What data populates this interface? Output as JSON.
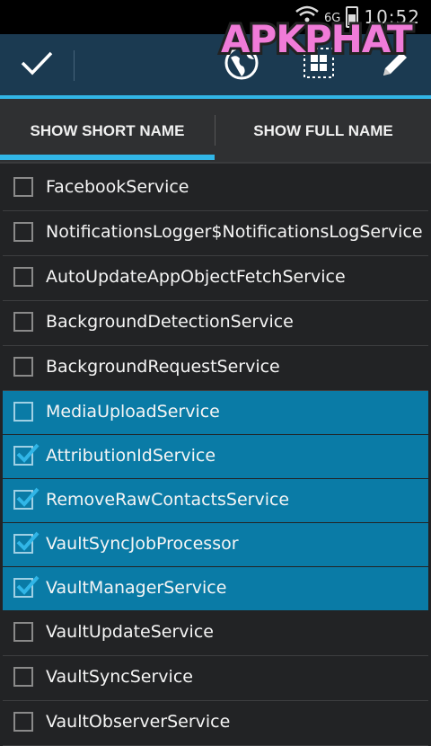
{
  "status": {
    "network": "6G",
    "clock": "10:52"
  },
  "watermark": {
    "text": "APKPHAT"
  },
  "actionbar": {
    "done_icon": "check-icon",
    "icons": [
      "globe-icon",
      "grid-select-icon",
      "pencil-icon"
    ]
  },
  "tabs": [
    {
      "label": "SHOW SHORT NAME",
      "active": true
    },
    {
      "label": "SHOW FULL NAME",
      "active": false
    }
  ],
  "services": [
    {
      "name": "FacebookService",
      "checked": false,
      "selected": false
    },
    {
      "name": "NotificationsLogger$NotificationsLogService",
      "checked": false,
      "selected": false
    },
    {
      "name": "AutoUpdateAppObjectFetchService",
      "checked": false,
      "selected": false
    },
    {
      "name": "BackgroundDetectionService",
      "checked": false,
      "selected": false
    },
    {
      "name": "BackgroundRequestService",
      "checked": false,
      "selected": false
    },
    {
      "name": "MediaUploadService",
      "checked": false,
      "selected": true
    },
    {
      "name": "AttributionIdService",
      "checked": true,
      "selected": true
    },
    {
      "name": "RemoveRawContactsService",
      "checked": true,
      "selected": true
    },
    {
      "name": "VaultSyncJobProcessor",
      "checked": true,
      "selected": true
    },
    {
      "name": "VaultManagerService",
      "checked": true,
      "selected": true
    },
    {
      "name": "VaultUpdateService",
      "checked": false,
      "selected": false
    },
    {
      "name": "VaultSyncService",
      "checked": false,
      "selected": false
    },
    {
      "name": "VaultObserverService",
      "checked": false,
      "selected": false
    }
  ],
  "colors": {
    "accent": "#31b6e7",
    "actionbar": "#1b3a51",
    "selected_row": "#0a7ba6",
    "watermark": "#f07bd8"
  }
}
